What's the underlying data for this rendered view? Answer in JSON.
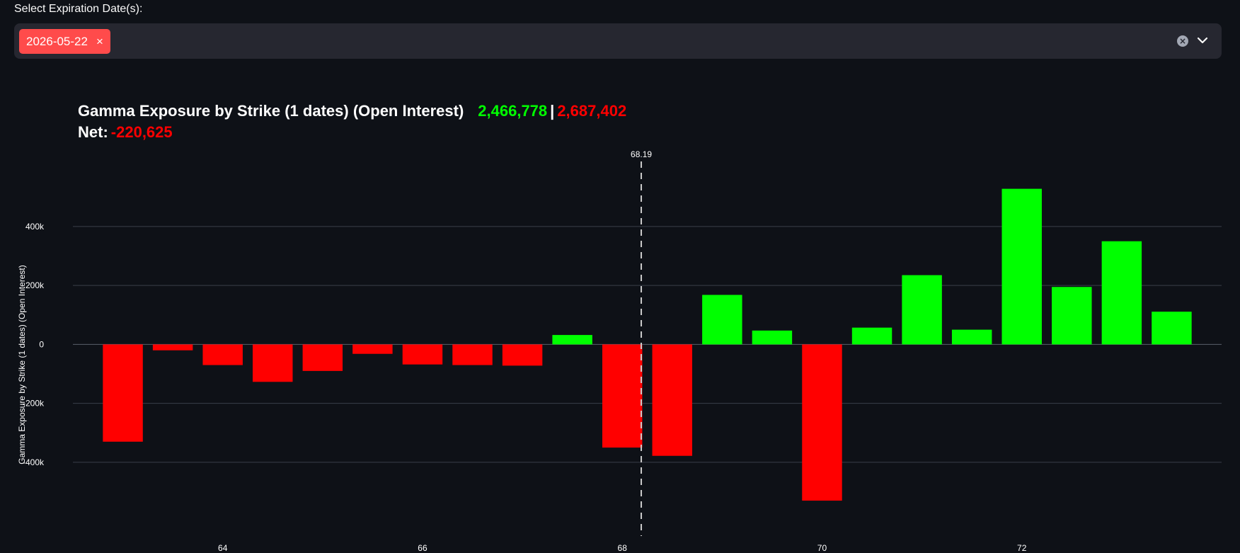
{
  "filter": {
    "label": "Select Expiration Date(s):",
    "selected_tag": "2026-05-22",
    "tag_remove_symbol": "×",
    "clear_symbol": "×",
    "dropdown_icon": "chevron-down-icon"
  },
  "header": {
    "title": "Gamma Exposure by Strike (1 dates) (Open Interest)",
    "positive_total": "2,466,778",
    "separator": "|",
    "negative_total": "2,687,402",
    "net_label": "Net:",
    "net_value": "-220,625"
  },
  "colors": {
    "background": "#0e1117",
    "positive": "#00ff00",
    "negative": "#ff0000",
    "grid": "#3a3f4a",
    "spot_line": "#cccccc"
  },
  "chart_data": {
    "type": "bar",
    "ylabel": "Gamma Exposure by Strike (1 dates) (Open Interest)",
    "xlabel": "",
    "x": [
      63,
      63.5,
      64,
      64.5,
      65,
      65.5,
      66,
      66.5,
      67,
      67.5,
      68,
      68.5,
      69,
      69.5,
      70,
      70.5,
      71,
      71.5,
      72,
      72.5,
      73,
      73.5
    ],
    "values": [
      -330000,
      -20000,
      -70000,
      -127000,
      -90000,
      -32000,
      -68000,
      -70000,
      -72000,
      32000,
      -350000,
      -378000,
      168000,
      47000,
      -530000,
      57000,
      235000,
      50000,
      528000,
      195000,
      350000,
      111000
    ],
    "xlim": [
      62.5,
      74
    ],
    "ylim": [
      -650000,
      640000
    ],
    "x_ticks": [
      64,
      66,
      68,
      70,
      72
    ],
    "x_tick_labels": [
      "64",
      "66",
      "68",
      "70",
      "72"
    ],
    "y_ticks": [
      400000,
      200000,
      0,
      -200000,
      -400000
    ],
    "y_tick_labels": [
      "400k",
      "200k",
      "0",
      "-200k",
      "-400k"
    ],
    "spot_price": 68.19,
    "spot_label": "68.19",
    "grid": true
  }
}
